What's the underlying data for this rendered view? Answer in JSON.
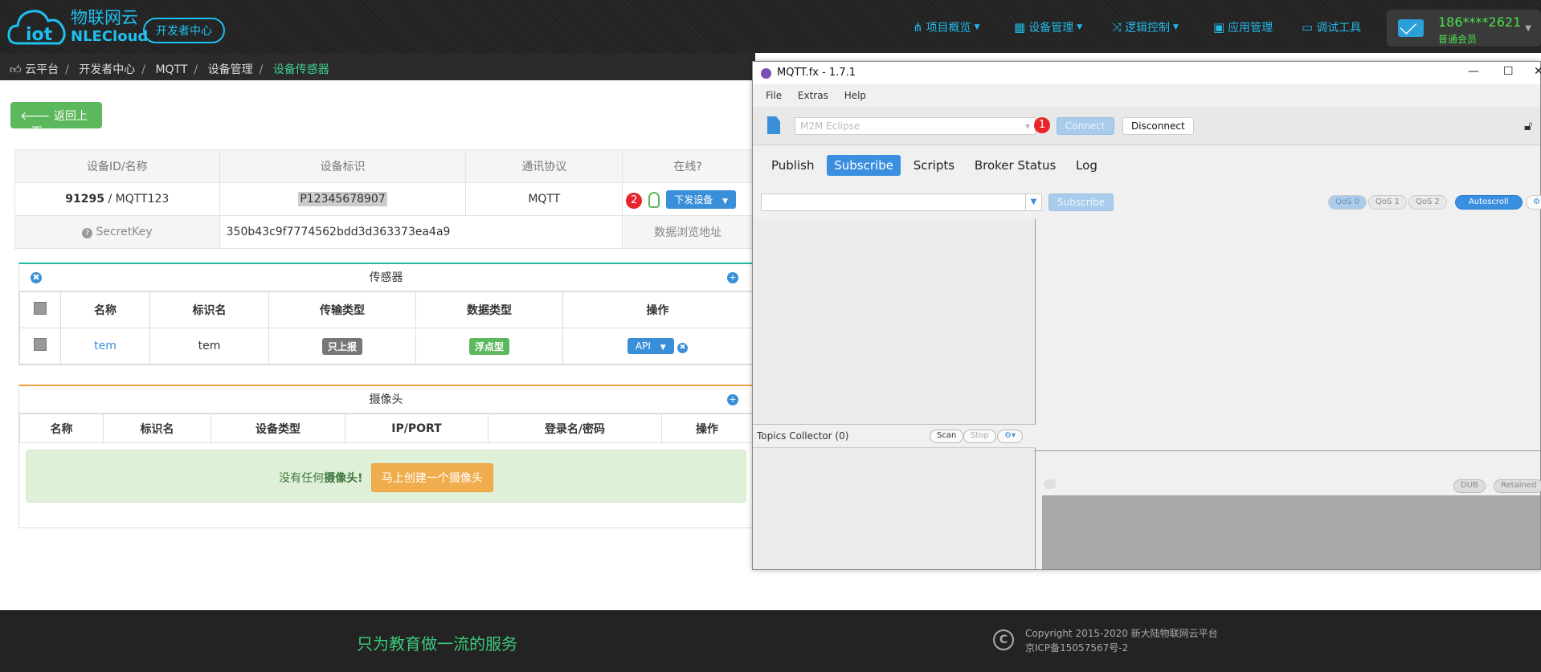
{
  "header": {
    "logo_cn": "物联网云",
    "logo_en": "NLECloud",
    "dev_center": "开发者中心",
    "nav": [
      {
        "label": "项目概览",
        "icon": "share-icon"
      },
      {
        "label": "设备管理",
        "icon": "grid-icon"
      },
      {
        "label": "逻辑控制",
        "icon": "shuffle-icon"
      },
      {
        "label": "应用管理",
        "icon": "briefcase-icon"
      },
      {
        "label": "调试工具",
        "icon": "laptop-icon"
      }
    ],
    "user_phone": "186****2621",
    "user_level": "普通会员"
  },
  "breadcrumb": [
    "云平台",
    "开发者中心",
    "MQTT",
    "设备管理",
    "设备传感器"
  ],
  "back_label": "返回上一页",
  "device": {
    "headers": [
      "设备ID/名称",
      "设备标识",
      "通讯协议",
      "在线?"
    ],
    "id": "91295",
    "name": "MQTT123",
    "identifier": "P12345678907",
    "protocol": "MQTT",
    "badge": "2",
    "send_label": "下发设备",
    "secret_label": "SecretKey",
    "secret_value": "350b43c9f7774562bdd3d363373ea4a9",
    "data_url_label": "数据浏览地址"
  },
  "sensors": {
    "title": "传感器",
    "headers": [
      "名称",
      "标识名",
      "传输类型",
      "数据类型",
      "操作"
    ],
    "row": {
      "name": "tem",
      "ident": "tem",
      "transfer": "只上报",
      "dtype": "浮点型",
      "op": "API"
    }
  },
  "cameras": {
    "title": "摄像头",
    "headers": [
      "名称",
      "标识名",
      "设备类型",
      "IP/PORT",
      "登录名/密码",
      "操作"
    ],
    "empty_text": "没有任何",
    "empty_bold": "摄像头!",
    "create_label": "马上创建一个摄像头"
  },
  "footer": {
    "slogan": "只为教育做一流的服务",
    "copyright": "Copyright 2015-2020 新大陆物联网云平台",
    "icp": "京ICP备15057567号-2"
  },
  "mqtt": {
    "title": "MQTT.fx - 1.7.1",
    "menu": [
      "File",
      "Extras",
      "Help"
    ],
    "profile": "M2M Eclipse",
    "badge": "1",
    "connect": "Connect",
    "disconnect": "Disconnect",
    "tabs": [
      "Publish",
      "Subscribe",
      "Scripts",
      "Broker Status",
      "Log"
    ],
    "subscribe_btn": "Subscribe",
    "qos": [
      "QoS 0",
      "QoS 1",
      "QoS 2"
    ],
    "autoscroll": "Autoscroll",
    "topics_collector": "Topics Collector (0)",
    "scan": "Scan",
    "stop": "Stop",
    "dub": "DUB",
    "retained": "Retained"
  },
  "colors": {
    "accent": "#1ec0f0",
    "green": "#5cb85c",
    "blue": "#3a8fd9"
  }
}
